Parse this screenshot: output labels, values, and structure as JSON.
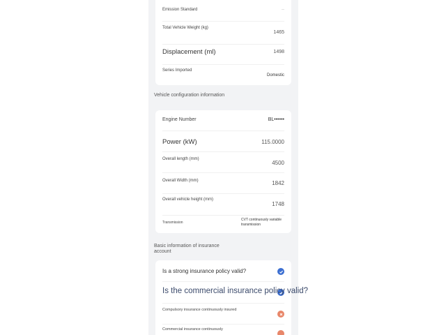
{
  "vehicle_card": {
    "rows": [
      {
        "label": "Emission Standard",
        "value": "--"
      },
      {
        "label": "Total Vehicle Weight (kg)",
        "value": "1465"
      },
      {
        "label": "Displacement (ml)",
        "value": "1498"
      },
      {
        "label": "Series Imported",
        "value": "Domestic"
      }
    ]
  },
  "config_section": {
    "title": "Vehicle configuration information",
    "rows": [
      {
        "label": "Engine Number",
        "value": "BL••••••"
      },
      {
        "label": "Power (kW)",
        "value": "115.0000"
      },
      {
        "label": "Overall length (mm)",
        "value": "4500"
      },
      {
        "label": "Overall Width (mm)",
        "value": "1842"
      },
      {
        "label": "Overall vehicle height (mm)",
        "value": "1748"
      },
      {
        "label": "Transmission",
        "value": "CVT continuously variable transmission"
      }
    ]
  },
  "insurance_section": {
    "title": "Basic information of insurance account",
    "rows": [
      {
        "label": "Is a strong insurance policy valid?",
        "status": "valid",
        "status_color": "#3c6fd1"
      },
      {
        "label": "Is the commercial insurance policy valid?",
        "status": "valid",
        "status_color": "#3c6fd1"
      },
      {
        "label": "Compulsory insurance continuously insured",
        "status": "invalid",
        "status_color": "#e8876a"
      },
      {
        "label": "Commercial insurance continuously",
        "status": "invalid",
        "status_color": "#e8876a"
      }
    ]
  }
}
